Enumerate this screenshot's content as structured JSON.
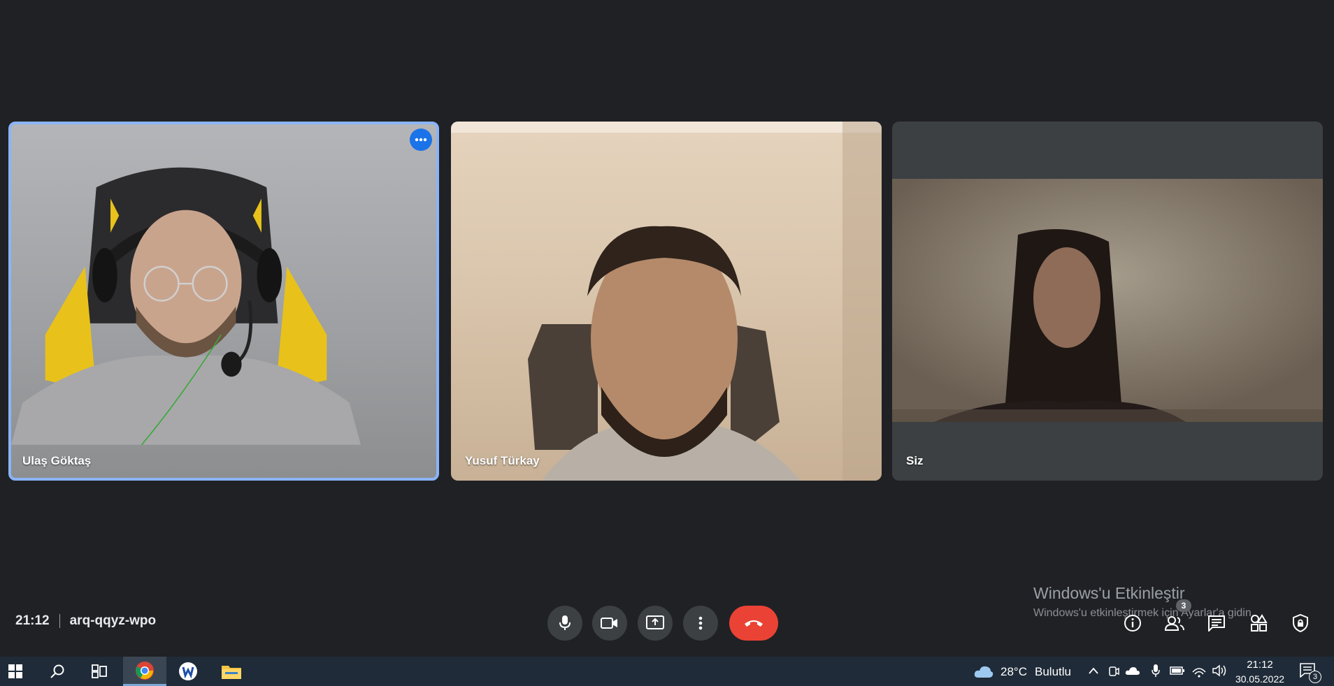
{
  "participants": [
    {
      "name": "Ulaş Göktaş",
      "active": true
    },
    {
      "name": "Yusuf Türkay",
      "active": false
    },
    {
      "name": "Siz",
      "active": false
    }
  ],
  "meeting": {
    "time": "21:12",
    "code": "arq-qqyz-wpo"
  },
  "controls": {
    "mic_icon": "microphone-icon",
    "camera_icon": "camera-icon",
    "present_icon": "present-screen-icon",
    "more_icon": "more-options-icon",
    "end_icon": "end-call-icon"
  },
  "right_panel": {
    "people_count": "3"
  },
  "watermark": {
    "title": "Windows'u Etkinleştir",
    "subtitle": "Windows'u etkinleştirmek için Ayarlar'a gidin."
  },
  "taskbar": {
    "weather_temp": "28°C",
    "weather_desc": "Bulutlu",
    "time": "21:12",
    "date": "30.05.2022",
    "notification_count": "3"
  },
  "colors": {
    "background": "#202124",
    "active_border": "#8ab4f8",
    "end_call": "#ea4335",
    "control": "#3c4043"
  }
}
